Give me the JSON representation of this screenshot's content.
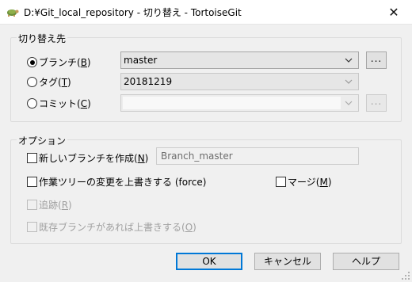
{
  "window": {
    "title": "D:¥Git_local_repository - 切り替え - TortoiseGit",
    "icon": "tortoisegit-icon",
    "close_glyph": "✕"
  },
  "switch_to": {
    "group_label": "切り替え先",
    "branch": {
      "text": "ブランチ(",
      "key": "B",
      "end": ")",
      "checked": true,
      "value": "master"
    },
    "tag": {
      "text": "タグ(",
      "key": "T",
      "end": ")",
      "checked": false,
      "value": "20181219"
    },
    "commit": {
      "text": "コミット(",
      "key": "C",
      "end": ")",
      "checked": false,
      "value": ""
    },
    "browse_label": "..."
  },
  "options": {
    "group_label": "オプション",
    "create_branch": {
      "text": "新しいブランチを作成(",
      "key": "N",
      "end": ")",
      "checked": false
    },
    "new_branch_name": "Branch_master",
    "force": {
      "text": "作業ツリーの変更を上書きする (force)",
      "checked": false
    },
    "merge": {
      "text": "マージ(",
      "key": "M",
      "end": ")",
      "checked": false
    },
    "track": {
      "text": "追跡(",
      "key": "R",
      "end": ")",
      "checked": false,
      "enabled": false
    },
    "override_existing": {
      "text": "既存ブランチがあれば上書きする(",
      "key": "O",
      "end": ")",
      "checked": false,
      "enabled": false
    }
  },
  "buttons": {
    "ok": "OK",
    "cancel": "キャンセル",
    "help": "ヘルプ"
  },
  "colors": {
    "dialog_bg": "#f0f0f0",
    "default_button_border": "#0078d7",
    "disabled_text": "#a0a0a0"
  }
}
